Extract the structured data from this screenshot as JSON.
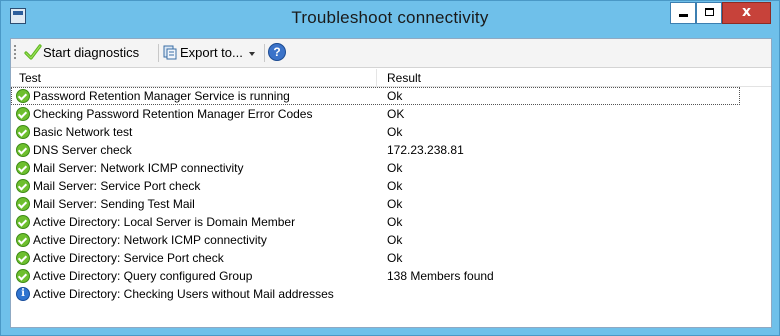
{
  "window": {
    "title": "Troubleshoot connectivity",
    "controls": {
      "minimize": "minimize",
      "maximize": "maximize",
      "close": "x"
    }
  },
  "toolbar": {
    "start_label": "Start diagnostics",
    "export_label": "Export to...",
    "help_label": "?"
  },
  "list": {
    "columns": {
      "test": "Test",
      "result": "Result"
    },
    "rows": [
      {
        "status": "ok",
        "test": "Password Retention Manager Service is running",
        "result": "Ok"
      },
      {
        "status": "ok",
        "test": "Checking Password Retention Manager Error Codes",
        "result": "OK"
      },
      {
        "status": "ok",
        "test": "Basic Network test",
        "result": "Ok"
      },
      {
        "status": "ok",
        "test": "DNS Server check",
        "result": "172.23.238.81"
      },
      {
        "status": "ok",
        "test": "Mail Server: Network ICMP connectivity",
        "result": "Ok"
      },
      {
        "status": "ok",
        "test": "Mail Server: Service Port check",
        "result": "Ok"
      },
      {
        "status": "ok",
        "test": "Mail Server: Sending Test Mail",
        "result": "Ok"
      },
      {
        "status": "ok",
        "test": "Active Directory: Local Server is Domain Member",
        "result": "Ok"
      },
      {
        "status": "ok",
        "test": "Active Directory: Network ICMP connectivity",
        "result": "Ok"
      },
      {
        "status": "ok",
        "test": "Active Directory: Service Port check",
        "result": "Ok"
      },
      {
        "status": "ok",
        "test": "Active Directory: Query configured Group",
        "result": "138 Members found"
      },
      {
        "status": "info",
        "test": "Active Directory: Checking Users without Mail addresses",
        "result": ""
      }
    ]
  },
  "colors": {
    "titlebar": "#6fc0ea",
    "close_button": "#c7423a",
    "ok_green": "#6dbf2e",
    "info_blue": "#2f74d0"
  },
  "icons": {
    "app": "app-icon",
    "start": "checkmark-icon",
    "export": "export-icon",
    "help": "help-icon",
    "ok": "check-circle-icon",
    "info": "info-circle-icon"
  }
}
